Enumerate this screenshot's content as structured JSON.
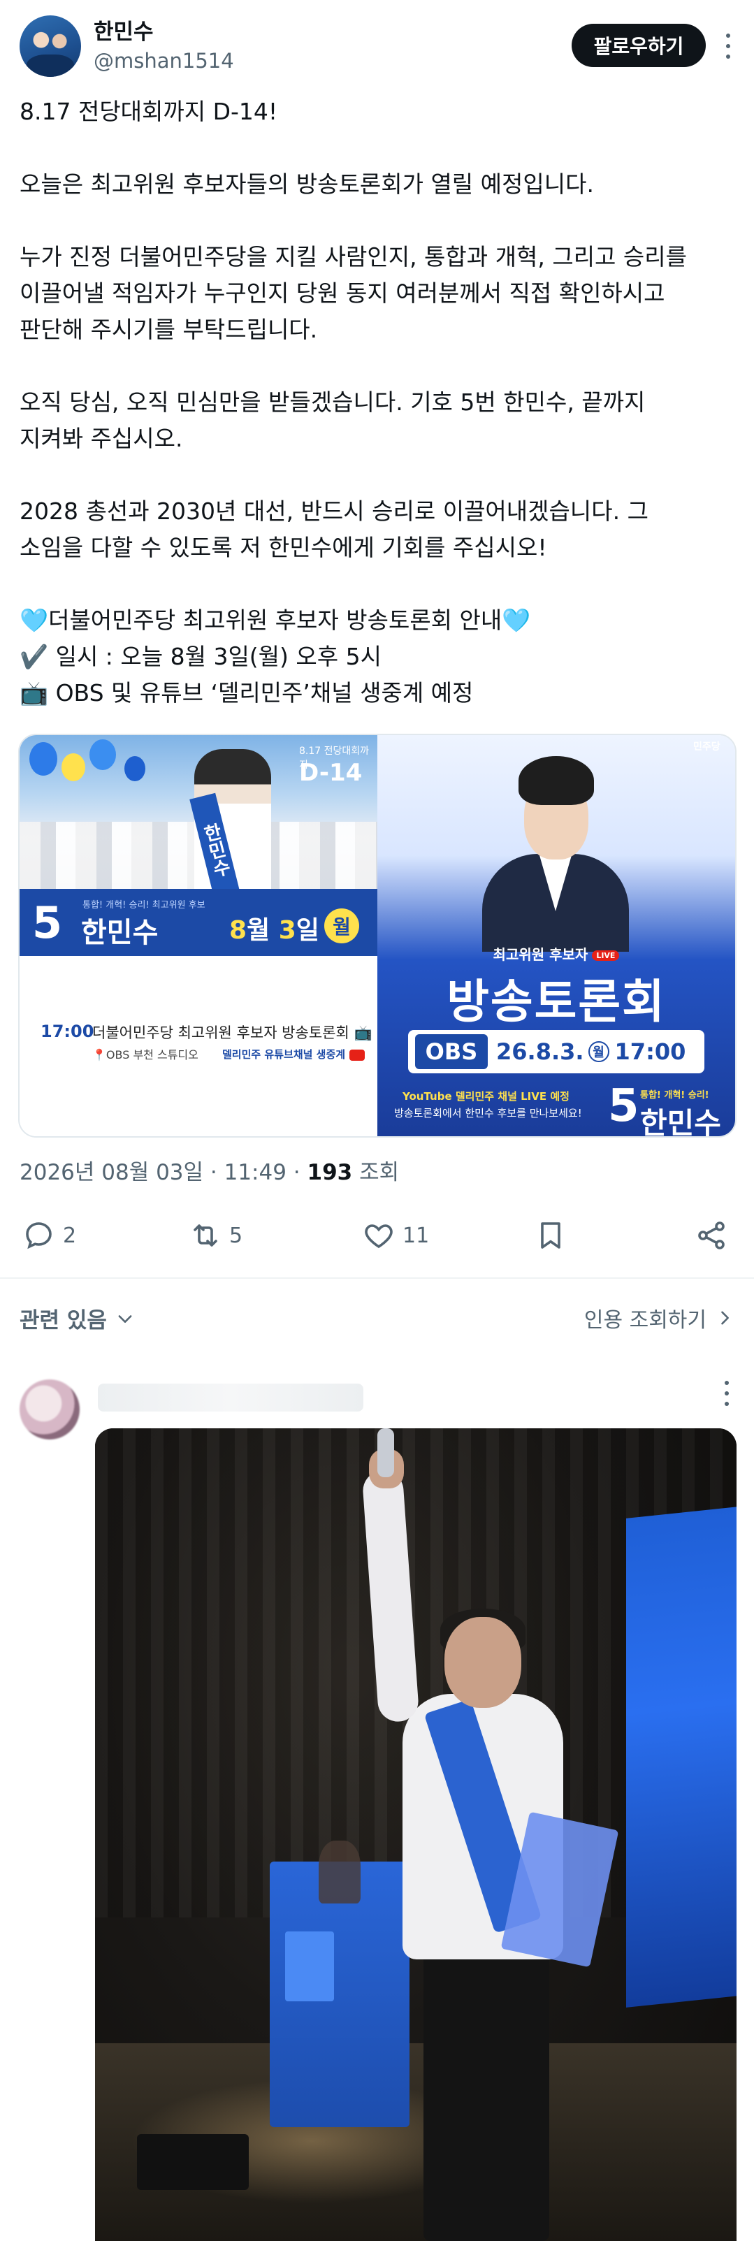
{
  "author": {
    "name": "한민수",
    "handle": "@mshan1514",
    "follow_label": "팔로우하기"
  },
  "tweet": {
    "text": "8.17 전당대회까지 D-14!\n\n오늘은 최고위원 후보자들의 방송토론회가 열릴 예정입니다.\n\n누가 진정 더불어민주당을 지킬 사람인지, 통합과 개혁, 그리고 승리를\n이끌어낼 적임자가 누구인지 당원 동지 여러분께서 직접 확인하시고\n판단해 주시기를 부탁드립니다.\n\n오직 당심, 오직 민심만을 받들겠습니다. 기호 5번 한민수, 끝까지\n지켜봐 주십시오.\n\n2028 총선과 2030년 대선, 반드시 승리로 이끌어내겠습니다. 그\n소임을 다할 수 있도록 저 한민수에게 기회를 주십시오!\n\n🩵더불어민주당 최고위원 후보자 방송토론회 안내🩵\n✔️ 일시 : 오늘 8월 3일(월) 오후 5시\n📺 OBS 및 유튜브 ‘델리민주’채널 생중계 예정"
  },
  "poster_left": {
    "top_small": "8.17 전당대회까지",
    "d_day": "D-14",
    "sash_text": "한민수",
    "number": "5",
    "slogan": "통합! 개혁! 승리! 최고위원 후보",
    "name": "한민수",
    "date_month": "8",
    "date_label_month": "월",
    "date_day": "3",
    "date_label_day": "일",
    "weekday": "월",
    "time": "17:00",
    "event": "더불어민주당 최고위원 후보자 방송토론회",
    "location": "OBS 부천 스튜디오",
    "channel": "델리민주 유튜브채널 생중계"
  },
  "poster_right": {
    "party": "민주당",
    "label": "최고위원 후보자",
    "live": "LIVE",
    "title": "방송토론회",
    "broadcaster": "OBS",
    "date": "26.8.3.",
    "weekday": "월",
    "time": "17:00",
    "youtube": "YouTube 델리민주 채널 LIVE 예정",
    "sub": "방송토론회에서 한민수 후보를 만나보세요!",
    "number": "5",
    "slogan": "통합! 개혁! 승리!",
    "name": "한민수"
  },
  "meta": {
    "datetime": "2026년 08월 03일 · 11:49 · ",
    "views_count": "193",
    "views_label": " 조회"
  },
  "actions": {
    "replies": "2",
    "retweets": "5",
    "likes": "11"
  },
  "related": {
    "label": "관련 있음",
    "quote_label": "인용 조회하기"
  },
  "colors": {
    "text": "#0f1419",
    "muted": "#536471",
    "brand_blue": "#1c4aa6",
    "accent_yellow": "#ffe14d"
  }
}
